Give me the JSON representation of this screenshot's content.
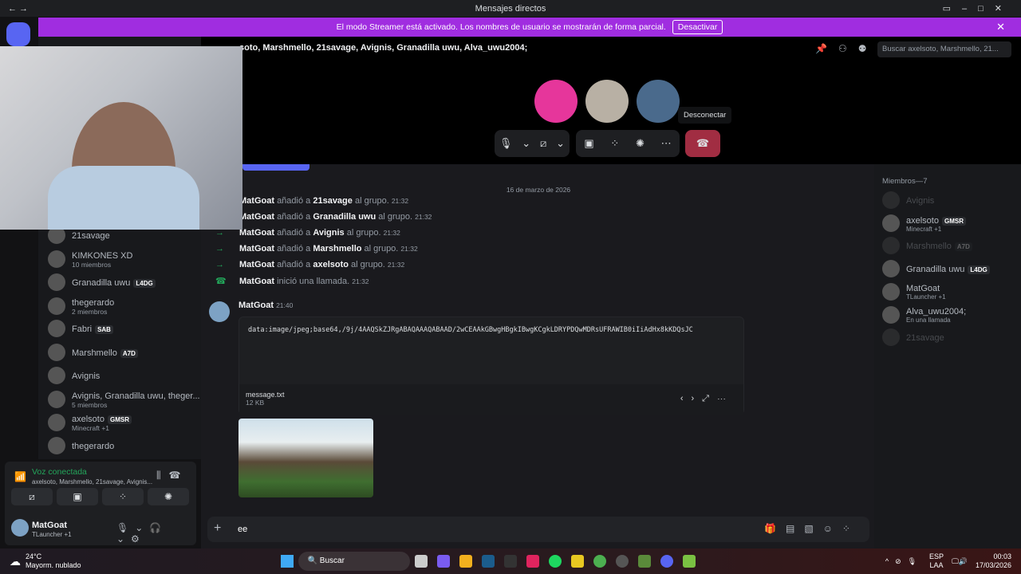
{
  "window": {
    "title": "Mensajes directos"
  },
  "banner": {
    "text": "El modo Streamer está activado. Los nombres de usuario se mostrarán de forma parcial.",
    "button": "Desactivar"
  },
  "header": {
    "title": "soto, Marshmello, 21savage, Avignis, Granadilla uwu, Alva_uwu2004;",
    "search_placeholder": "Buscar axelsoto, Marshmello, 21..."
  },
  "call": {
    "tooltip": "Desconectar",
    "accent": "#a12d42"
  },
  "dm_list": [
    {
      "name": "21savage",
      "sub": "",
      "tag": ""
    },
    {
      "name": "KIMKONES XD",
      "sub": "10 miembros",
      "tag": ""
    },
    {
      "name": "Granadilla uwu",
      "sub": "",
      "tag": "L4DG"
    },
    {
      "name": "thegerardo",
      "sub": "2 miembros",
      "tag": ""
    },
    {
      "name": "Fabri",
      "sub": "",
      "tag": "SAB"
    },
    {
      "name": "Marshmello",
      "sub": "",
      "tag": "A7D"
    },
    {
      "name": "Avignis",
      "sub": "",
      "tag": ""
    },
    {
      "name": "Avignis, Granadilla uwu, theger...",
      "sub": "5 miembros",
      "tag": ""
    },
    {
      "name": "axelsoto",
      "sub": "Minecraft +1",
      "tag": "GMSR"
    },
    {
      "name": "thegerardo",
      "sub": "",
      "tag": ""
    }
  ],
  "voice": {
    "status": "Voz conectada",
    "users": "axelsoto, Marshmello, 21savage, Avignis..."
  },
  "user": {
    "name": "MatGoat",
    "activity": "TLauncher +1"
  },
  "chat": {
    "date": "16 de marzo de 2026",
    "system": [
      {
        "actor": "MatGoat",
        "verb": "añadió a",
        "target": "21savage",
        "rest": "al grupo.",
        "time": "21:32"
      },
      {
        "actor": "MatGoat",
        "verb": "añadió a",
        "target": "Granadilla uwu",
        "rest": "al grupo.",
        "time": "21:32"
      },
      {
        "actor": "MatGoat",
        "verb": "añadió a",
        "target": "Avignis",
        "rest": "al grupo.",
        "time": "21:32"
      },
      {
        "actor": "MatGoat",
        "verb": "añadió a",
        "target": "Marshmello",
        "rest": "al grupo.",
        "time": "21:32"
      },
      {
        "actor": "MatGoat",
        "verb": "añadió a",
        "target": "axelsoto",
        "rest": "al grupo.",
        "time": "21:32"
      },
      {
        "actor": "MatGoat",
        "verb": "inició una llamada.",
        "target": "",
        "rest": "",
        "time": "21:32"
      }
    ],
    "message": {
      "author": "MatGoat",
      "time": "21:40",
      "file_preview": "data:image/jpeg;base64,/9j/4AAQSkZJRgABAQAAAQABAAD/2wCEAAkGBwgHBgkIBwgKCgkLDRYPDQwMDRsUFRAWIB0iIiAdHx8kKDQsJC",
      "file_name": "message.txt",
      "file_size": "12 KB"
    },
    "input_value": "ee"
  },
  "members": {
    "header": "Miembros—7",
    "list": [
      {
        "name": "Avignis",
        "sub": "",
        "tag": "",
        "dim": true
      },
      {
        "name": "axelsoto",
        "sub": "Minecraft +1",
        "tag": "GMSR",
        "dim": false
      },
      {
        "name": "Marshmello",
        "sub": "",
        "tag": "A7D",
        "dim": true
      },
      {
        "name": "Granadilla uwu",
        "sub": "",
        "tag": "L4DG",
        "dim": false
      },
      {
        "name": "MatGoat",
        "sub": "TLauncher +1",
        "tag": "",
        "dim": false
      },
      {
        "name": "Alva_uwu2004;",
        "sub": "En una llamada",
        "tag": "",
        "dim": false
      },
      {
        "name": "21savage",
        "sub": "",
        "tag": "",
        "dim": true
      }
    ]
  },
  "taskbar": {
    "temp": "24°C",
    "weather": "Mayorm. nublado",
    "search": "Buscar",
    "lang1": "ESP",
    "lang2": "LAA",
    "time": "00:03",
    "date": "17/03/2026"
  }
}
